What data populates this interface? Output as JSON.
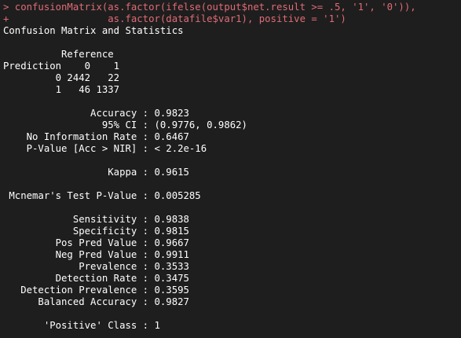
{
  "console": {
    "command": [
      "> confusionMatrix(as.factor(ifelse(output$net.result >= .5, '1', '0')),",
      "+                 as.factor(datafile$var1), positive = '1')"
    ],
    "output": [
      "Confusion Matrix and Statistics",
      "",
      "          Reference",
      "Prediction    0    1",
      "         0 2442   22",
      "         1   46 1337",
      "",
      "               Accuracy : 0.9823",
      "                 95% CI : (0.9776, 0.9862)",
      "    No Information Rate : 0.6467",
      "    P-Value [Acc > NIR] : < 2.2e-16",
      "",
      "                  Kappa : 0.9615",
      "",
      " Mcnemar's Test P-Value : 0.005285",
      "",
      "            Sensitivity : 0.9838",
      "            Specificity : 0.9815",
      "         Pos Pred Value : 0.9667",
      "         Neg Pred Value : 0.9911",
      "             Prevalence : 0.3533",
      "         Detection Rate : 0.3475",
      "   Detection Prevalence : 0.3595",
      "      Balanced Accuracy : 0.9827",
      "",
      "       'Positive' Class : 1"
    ]
  },
  "colors": {
    "background": "#1e1e1e",
    "command_text": "#e06c75",
    "output_text": "#ffffff"
  }
}
